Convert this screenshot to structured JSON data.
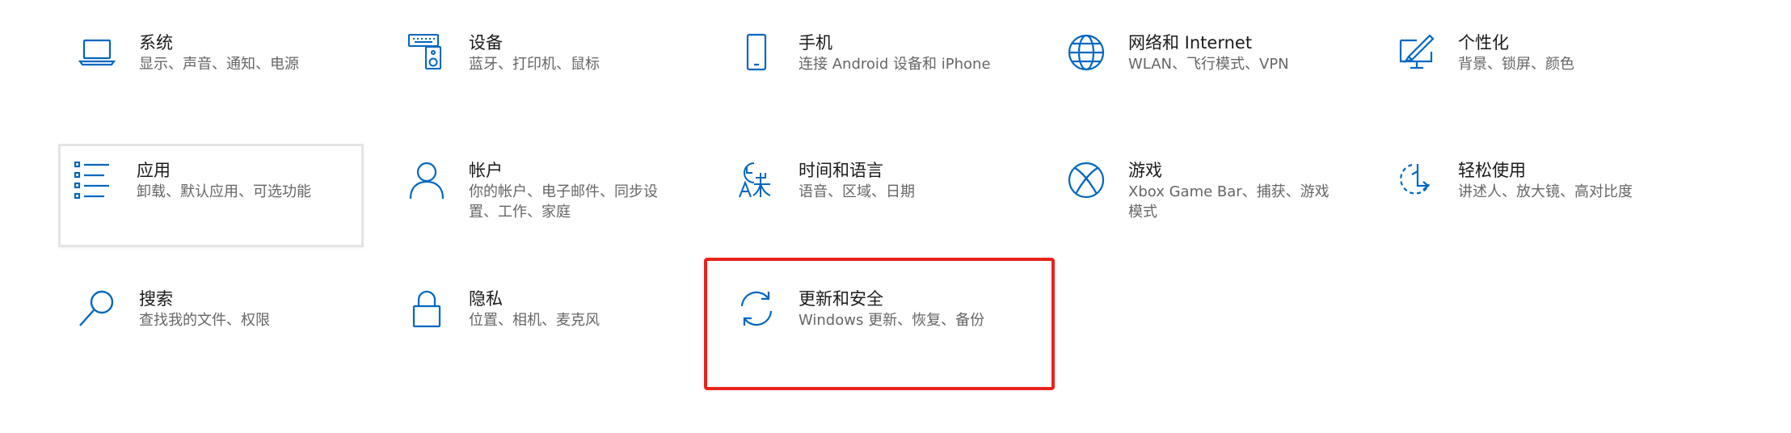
{
  "accent_color": "#0067c0",
  "highlight_color": "#e8231b",
  "tiles": [
    {
      "title": "系统",
      "desc": "显示、声音、通知、电源",
      "icon": "laptop-icon"
    },
    {
      "title": "设备",
      "desc": "蓝牙、打印机、鼠标",
      "icon": "keyboard-speaker-icon"
    },
    {
      "title": "手机",
      "desc": "连接 Android 设备和 iPhone",
      "icon": "phone-icon"
    },
    {
      "title": "网络和 Internet",
      "desc": "WLAN、飞行模式、VPN",
      "icon": "globe-icon"
    },
    {
      "title": "个性化",
      "desc": "背景、锁屏、颜色",
      "icon": "paint-brush-icon"
    },
    {
      "title": "应用",
      "desc": "卸载、默认应用、可选功能",
      "icon": "apps-list-icon"
    },
    {
      "title": "帐户",
      "desc": "你的帐户、电子邮件、同步设置、工作、家庭",
      "icon": "person-icon"
    },
    {
      "title": "时间和语言",
      "desc": "语音、区域、日期",
      "icon": "time-language-icon"
    },
    {
      "title": "游戏",
      "desc": "Xbox Game Bar、捕获、游戏模式",
      "icon": "xbox-icon"
    },
    {
      "title": "轻松使用",
      "desc": "讲述人、放大镜、高对比度",
      "icon": "ease-of-access-icon"
    },
    {
      "title": "搜索",
      "desc": "查找我的文件、权限",
      "icon": "search-icon"
    },
    {
      "title": "隐私",
      "desc": "位置、相机、麦克风",
      "icon": "lock-icon"
    },
    {
      "title": "更新和安全",
      "desc": "Windows 更新、恢复、备份",
      "icon": "sync-icon"
    }
  ]
}
